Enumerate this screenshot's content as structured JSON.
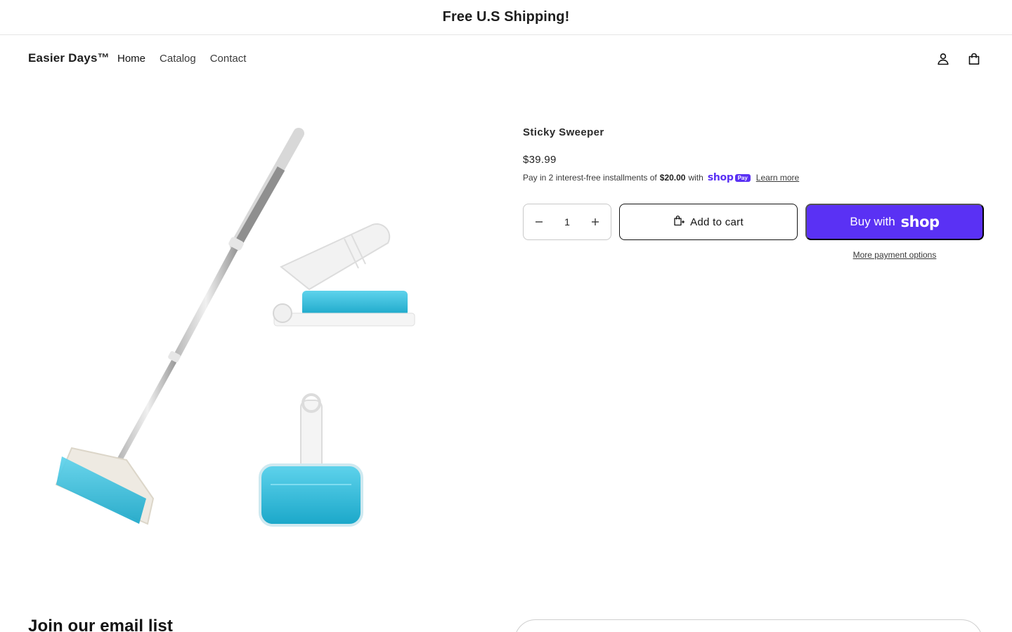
{
  "announcement": {
    "text": "Free U.S Shipping!"
  },
  "header": {
    "logo": "Easier Days™",
    "nav": [
      {
        "label": "Home"
      },
      {
        "label": "Catalog"
      },
      {
        "label": "Contact"
      }
    ],
    "icons": {
      "account": "account-icon",
      "cart": "cart-icon"
    }
  },
  "product": {
    "image_description_icon": "product-image",
    "title": "Sticky Sweeper",
    "price": "$39.99",
    "installments": {
      "prefix": "Pay in 2 interest-free installments of",
      "amount": "$20.00",
      "with": "with",
      "brand_word": "shop",
      "brand_pill": "Pay",
      "learn_more": "Learn more"
    },
    "quantity": {
      "value": "1",
      "minus_icon": "minus-icon",
      "plus_icon": "plus-icon"
    },
    "add_to_cart": "Add to cart",
    "buy_with": {
      "prefix": "Buy with",
      "brand": "shop"
    },
    "more_payment": "More payment options"
  },
  "footer": {
    "email_heading": "Join our email list"
  },
  "colors": {
    "shop_purple": "#5a31f4",
    "text": "#121212",
    "border": "#c8c8c8"
  }
}
